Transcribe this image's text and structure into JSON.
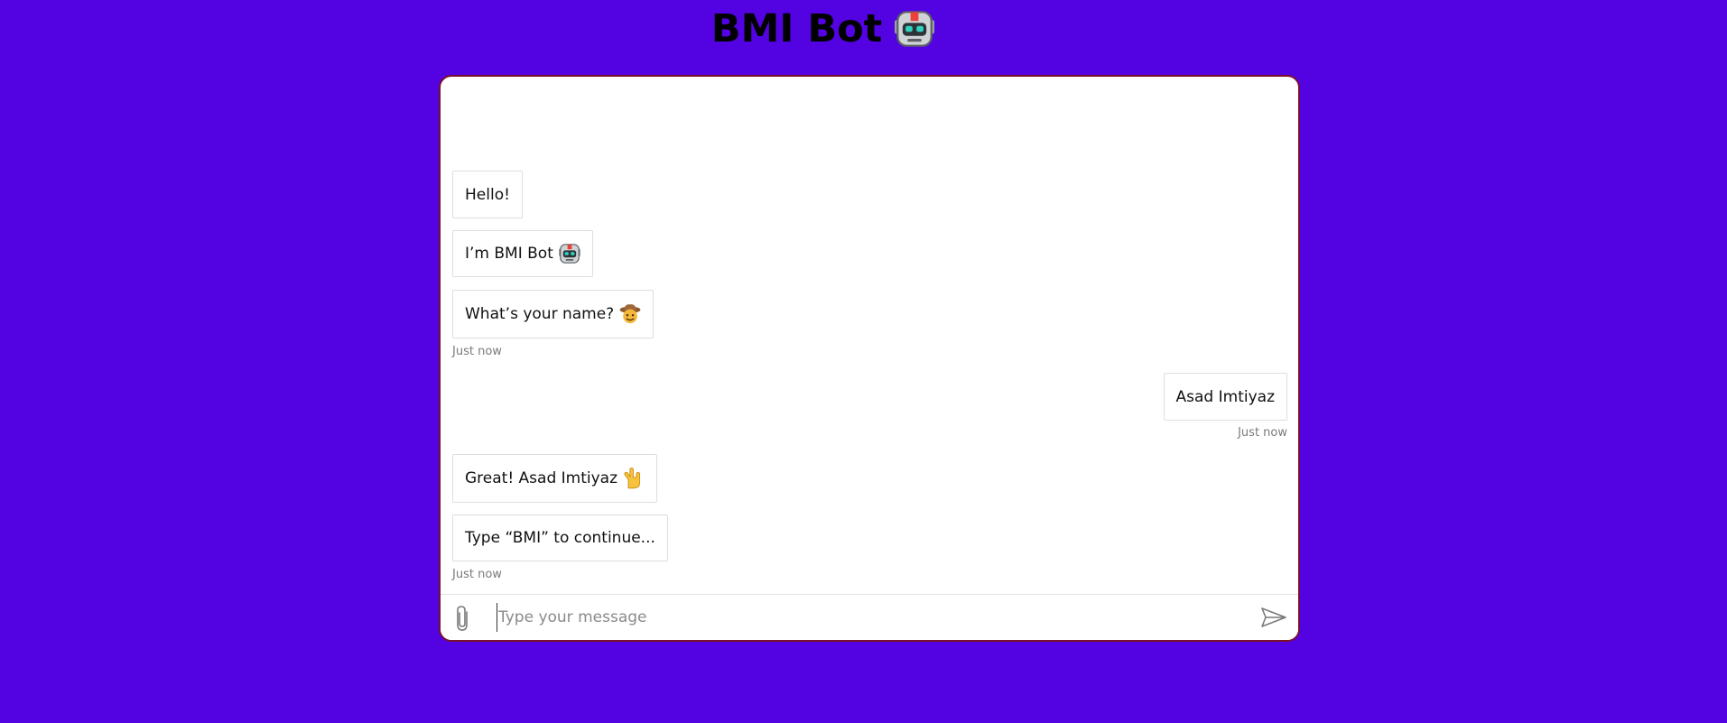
{
  "header": {
    "title": "BMI Bot",
    "icon": "robot-icon"
  },
  "messages": [
    {
      "sender": "bot",
      "text": "Hello!"
    },
    {
      "sender": "bot",
      "text": "I’m BMI Bot",
      "emoji": "robot-icon"
    },
    {
      "sender": "bot",
      "text": "What’s your name?",
      "emoji": "cowboy-face-icon"
    },
    {
      "sender": "user",
      "text": "Asad Imtiyaz"
    },
    {
      "sender": "bot",
      "text": "Great! Asad Imtiyaz",
      "emoji": "love-you-gesture-icon"
    },
    {
      "sender": "bot",
      "text": "Type “BMI” to continue..."
    }
  ],
  "timestamps": {
    "group1": "Just now",
    "group2": "Just now",
    "group3": "Just now"
  },
  "composer": {
    "placeholder": "Type your message",
    "value": "",
    "attach_icon": "paperclip-icon",
    "send_icon": "send-icon"
  },
  "colors": {
    "background": "#5303e2",
    "chat_border": "#7a0f2a",
    "bubble_bg": "#ffffff",
    "bubble_border": "#dedede",
    "timestamp": "#7a7a7a"
  }
}
